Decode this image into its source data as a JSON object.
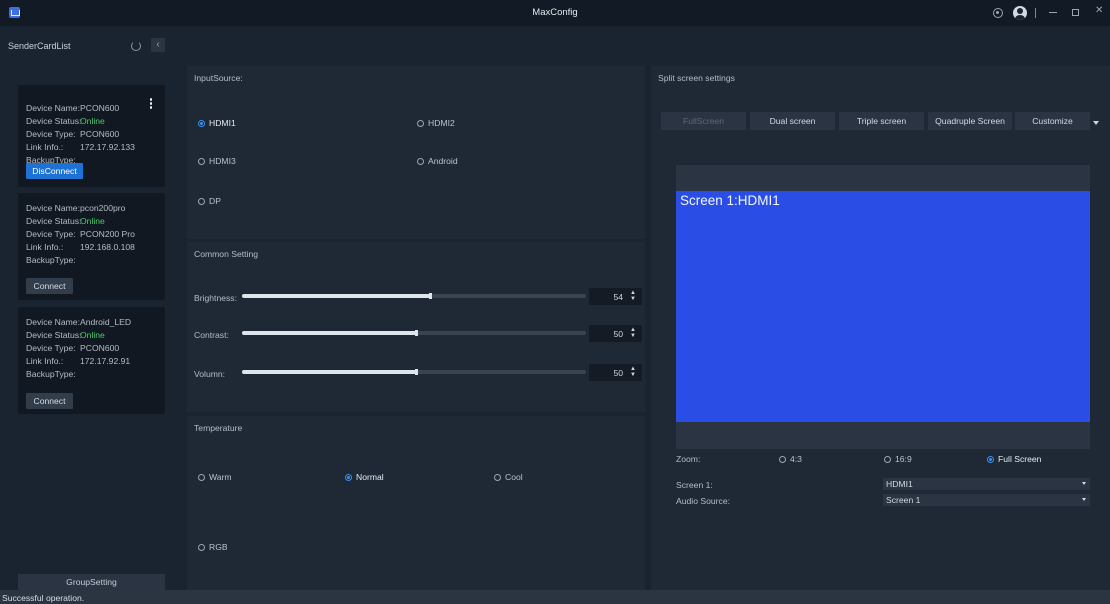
{
  "window": {
    "title": "MaxConfig"
  },
  "sidebar": {
    "title": "SenderCardList",
    "labels": {
      "name": "Device Name:",
      "status": "Device Status:",
      "type": "Device Type:",
      "link": "Link Info.:",
      "backup": "BackupType:"
    },
    "cards": [
      {
        "name": "PCON600",
        "status": "Online",
        "type": "PCON600",
        "link": "172.17.92.133",
        "backup": "",
        "button": "DisConnect"
      },
      {
        "name": "pcon200pro",
        "status": "Online",
        "type": "PCON200 Pro",
        "link": "192.168.0.108",
        "backup": "",
        "button": "Connect"
      },
      {
        "name": "Android_LED",
        "status": "Online",
        "type": "PCON600",
        "link": "172.17.92.91",
        "backup": "",
        "button": "Connect"
      }
    ],
    "group_button": "GroupSetting"
  },
  "input_source": {
    "title": "InputSource:",
    "options": [
      "HDMI1",
      "HDMI2",
      "HDMI3",
      "Android",
      "DP"
    ],
    "selected": "HDMI1"
  },
  "common_setting": {
    "title": "Common Setting",
    "sliders": [
      {
        "label": "Brightness:",
        "value": "54",
        "fill": 0.55
      },
      {
        "label": "Contrast:",
        "value": "50",
        "fill": 0.51
      },
      {
        "label": "Volumn:",
        "value": "50",
        "fill": 0.51
      }
    ]
  },
  "temperature": {
    "title": "Temperature",
    "options": [
      "Warm",
      "Normal",
      "Cool",
      "RGB"
    ],
    "selected": "Normal"
  },
  "split": {
    "title": "Split screen settings",
    "tabs": [
      "FullScreen",
      "Dual screen",
      "Triple screen",
      "Quadruple Screen",
      "Customize"
    ],
    "preview_label": "Screen 1:HDMI1",
    "zoom_label": "Zoom:",
    "zoom_options": [
      "4:3",
      "16:9",
      "Full Screen"
    ],
    "zoom_selected": "Full Screen",
    "screen1_label": "Screen 1:",
    "screen1_value": "HDMI1",
    "audio_label": "Audio Source:",
    "audio_value": "Screen 1"
  },
  "status": {
    "text": "Successful operation."
  },
  "colors": {
    "accent": "#1e72d6",
    "online": "#4ec970",
    "preview": "#2a4de6",
    "background": "#1a2330"
  }
}
